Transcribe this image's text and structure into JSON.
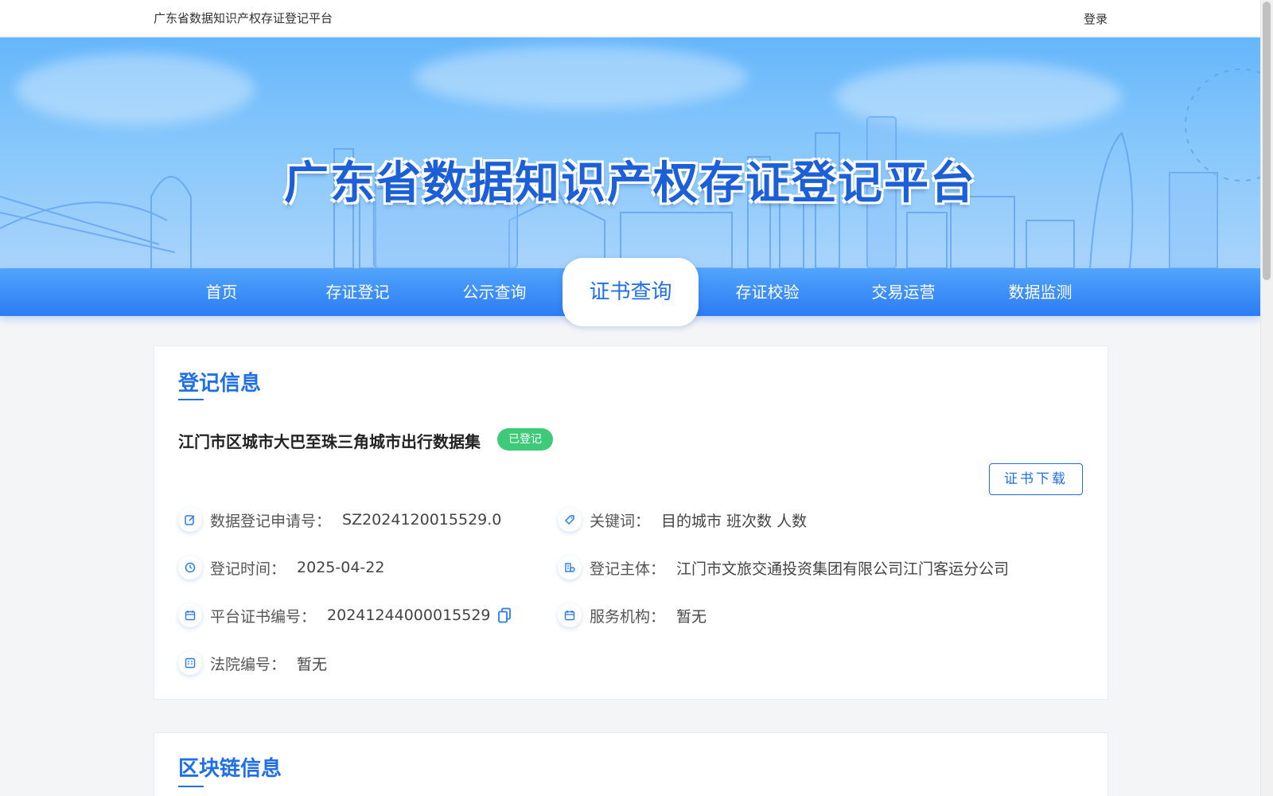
{
  "topbar": {
    "site_name": "广东省数据知识产权存证登记平台",
    "login": "登录"
  },
  "banner": {
    "title": "广东省数据知识产权存证登记平台"
  },
  "nav": {
    "items": [
      {
        "label": "首页"
      },
      {
        "label": "存证登记"
      },
      {
        "label": "公示查询"
      },
      {
        "label": "证书查询",
        "active": true
      },
      {
        "label": "存证校验"
      },
      {
        "label": "交易运营"
      },
      {
        "label": "数据监测"
      }
    ]
  },
  "registration": {
    "title": "登记信息",
    "dataset_name": "江门市区城市大巴至珠三角城市出行数据集",
    "status": "已登记",
    "download_button": "证书下载",
    "fields": {
      "application_no": {
        "label": "数据登记申请号：",
        "value": "SZ2024120015529.0",
        "icon": "edit-icon"
      },
      "keywords": {
        "label": "关键词：",
        "value": "目的城市 班次数 人数",
        "icon": "tag-icon"
      },
      "reg_time": {
        "label": "登记时间：",
        "value": "2025-04-22",
        "icon": "clock-icon"
      },
      "subject": {
        "label": "登记主体：",
        "value": "江门市文旅交通投资集团有限公司江门客运分公司",
        "icon": "organization-icon"
      },
      "cert_no": {
        "label": "平台证书编号：",
        "value": "20241244000015529",
        "icon": "calendar-icon"
      },
      "service_org": {
        "label": "服务机构：",
        "value": "暂无",
        "icon": "calendar-icon"
      },
      "court_no": {
        "label": "法院编号：",
        "value": "暂无",
        "icon": "document-icon"
      }
    }
  },
  "blockchain": {
    "title": "区块链信息"
  },
  "colors": {
    "primary": "#1f6fe8",
    "success": "#3fca7a",
    "nav_top": "#52a4fb",
    "nav_bottom": "#2c7cf5"
  }
}
